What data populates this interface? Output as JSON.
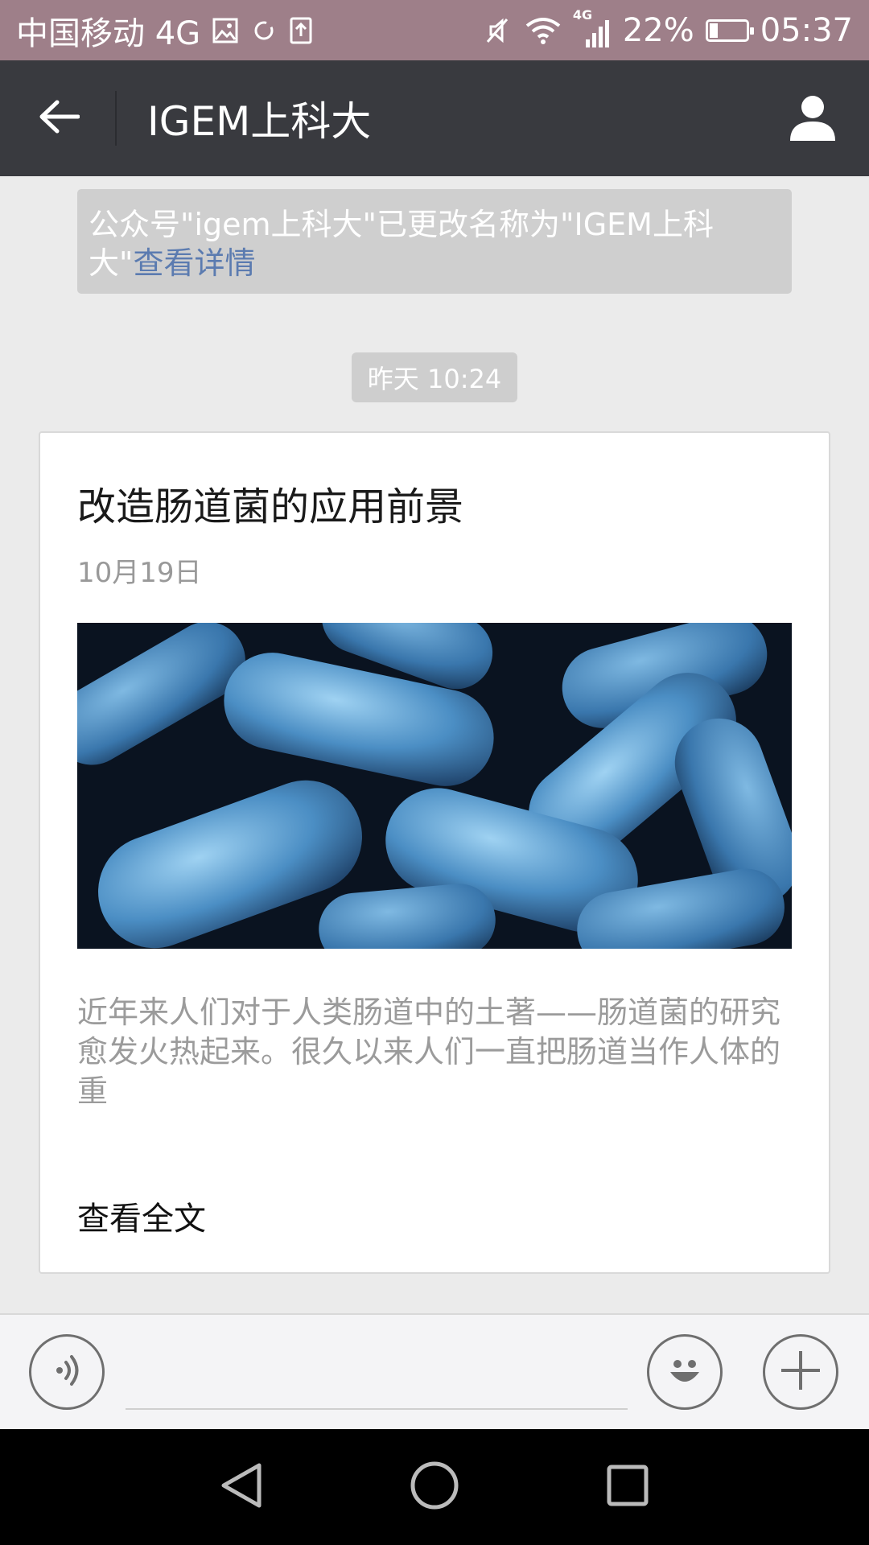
{
  "status_bar": {
    "carrier": "中国移动 4G",
    "network_small": "4G",
    "battery_percent": "22%",
    "battery_level": 0.22,
    "time": "05:37",
    "icons": [
      "image-icon",
      "sync-icon",
      "upload-icon",
      "mute-icon",
      "wifi-icon",
      "signal-icon",
      "battery-icon"
    ]
  },
  "header": {
    "title": "IGEM上科大",
    "back_icon": "back-arrow-icon",
    "profile_icon": "person-icon"
  },
  "notice": {
    "text": "公众号\"igem上科大\"已更改名称为\"IGEM上科大\"",
    "link": "查看详情"
  },
  "timestamp": "昨天 10:24",
  "article": {
    "title": "改造肠道菌的应用前景",
    "date": "10月19日",
    "image_description_icon": "bacteria-image",
    "digest": "近年来人们对于人类肠道中的土著——肠道菌的研究愈发火热起来。很久以来人们一直把肠道当作人体的重",
    "read_more": "查看全文"
  },
  "input_bar": {
    "voice_icon": "voice-icon",
    "emoji_icon": "emoji-icon",
    "plus_icon": "plus-icon",
    "placeholder": ""
  },
  "nav_bar": {
    "icons": [
      "nav-back-icon",
      "nav-home-icon",
      "nav-recents-icon"
    ]
  },
  "colors": {
    "status_bar": "#9e7f89",
    "header": "#393a3f",
    "background": "#ebebeb",
    "link": "#5b7bb0"
  }
}
